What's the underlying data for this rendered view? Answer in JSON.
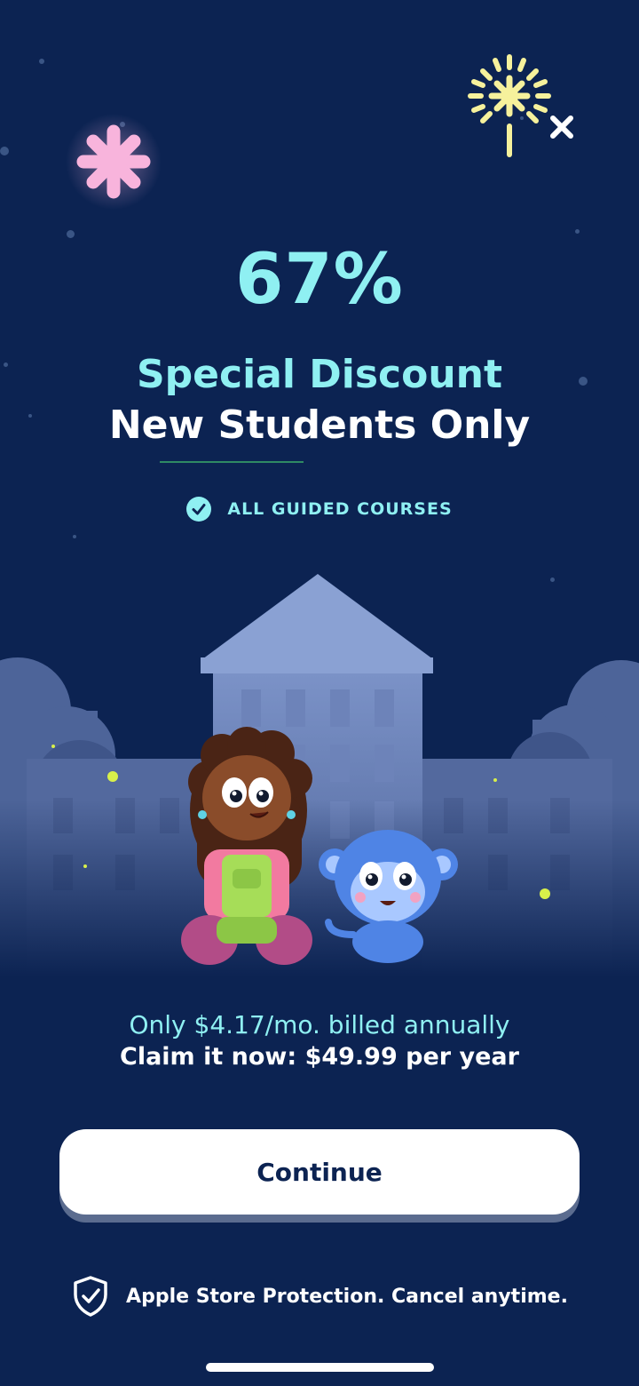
{
  "headline": {
    "percent": "67%",
    "title_line1": "Special Discount",
    "title_line2": "New Students Only"
  },
  "badge": {
    "label": "ALL GUIDED COURSES",
    "icon": "check-circle-icon"
  },
  "pricing": {
    "monthly_text": "Only $4.17/mo. billed annually",
    "claim_text": "Claim it now: $49.99 per year"
  },
  "cta": {
    "continue_label": "Continue"
  },
  "footer": {
    "protection_text": "Apple Store Protection. Cancel anytime.",
    "icon": "shield-check-icon"
  },
  "close": {
    "icon": "close-icon"
  },
  "colors": {
    "background": "#0c2352",
    "accent_cyan": "#8ff0f2",
    "button": "#ffffff",
    "sparkle_pink": "#f8b4dc",
    "sparkle_yellow": "#f6f19c",
    "firefly": "#d8f04a"
  }
}
